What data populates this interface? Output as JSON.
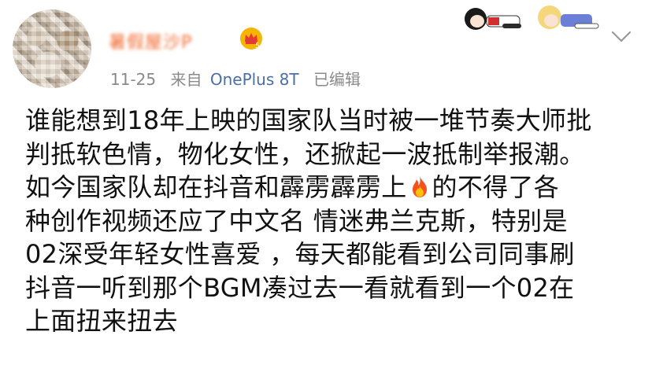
{
  "post": {
    "username": "暑假屋沙P",
    "vip_badge_level": "5",
    "date": "11-25",
    "source_prefix": "来自",
    "source": "OnePlus 8T",
    "edited": "已编辑",
    "content_lines": [
      "谁能想到18年上映的国家队当时被一堆节奏大师批",
      "判抵软色情，物化女性，还掀起一波抵制举报潮。",
      "如今国家队却在抖音和霹雳霹雳上",
      "的不得了各",
      "种创作视频还应了中文名 情迷弗兰克斯，特别是",
      "02深受年轻女性喜爱 ，每天都能看到公司同事刷",
      "抖音一听到那个BGM凑过去一看就看到一个02在",
      "上面扭来扭去"
    ],
    "inline_icon": "fire-icon"
  },
  "colors": {
    "username": "#f06a2e",
    "meta": "#8a8a8a",
    "source": "#4a6fa5",
    "text": "#111111"
  }
}
